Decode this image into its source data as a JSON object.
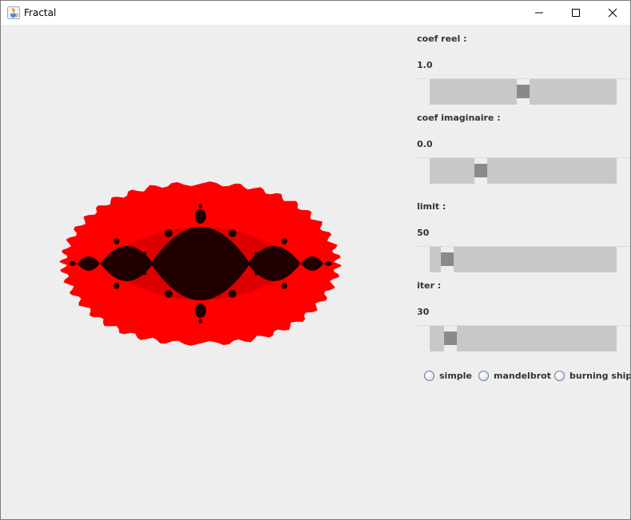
{
  "window": {
    "title": "Fractal",
    "icon": "java-cup-icon"
  },
  "titlebar_buttons": {
    "minimize": "minimize-icon",
    "maximize": "maximize-icon",
    "close": "close-icon"
  },
  "fractal": {
    "type": "julia set",
    "colors": {
      "background": "#eeeeee",
      "outer": "#ff0000",
      "mid": "#dd0000",
      "inner": "#200000"
    }
  },
  "controls": {
    "real": {
      "label": "coef reel :",
      "value": "1.0",
      "slider_fraction": 0.5
    },
    "imag": {
      "label": "coef imaginaire :",
      "value": "0.0",
      "slider_fraction": 0.25
    },
    "limit": {
      "label": "limit :",
      "value": "50",
      "slider_fraction": 0.05
    },
    "iter": {
      "label": "iter :",
      "value": "30",
      "slider_fraction": 0.07
    }
  },
  "radio": {
    "options": [
      "simple",
      "mandelbrot",
      "burning ship"
    ],
    "selected": null
  }
}
